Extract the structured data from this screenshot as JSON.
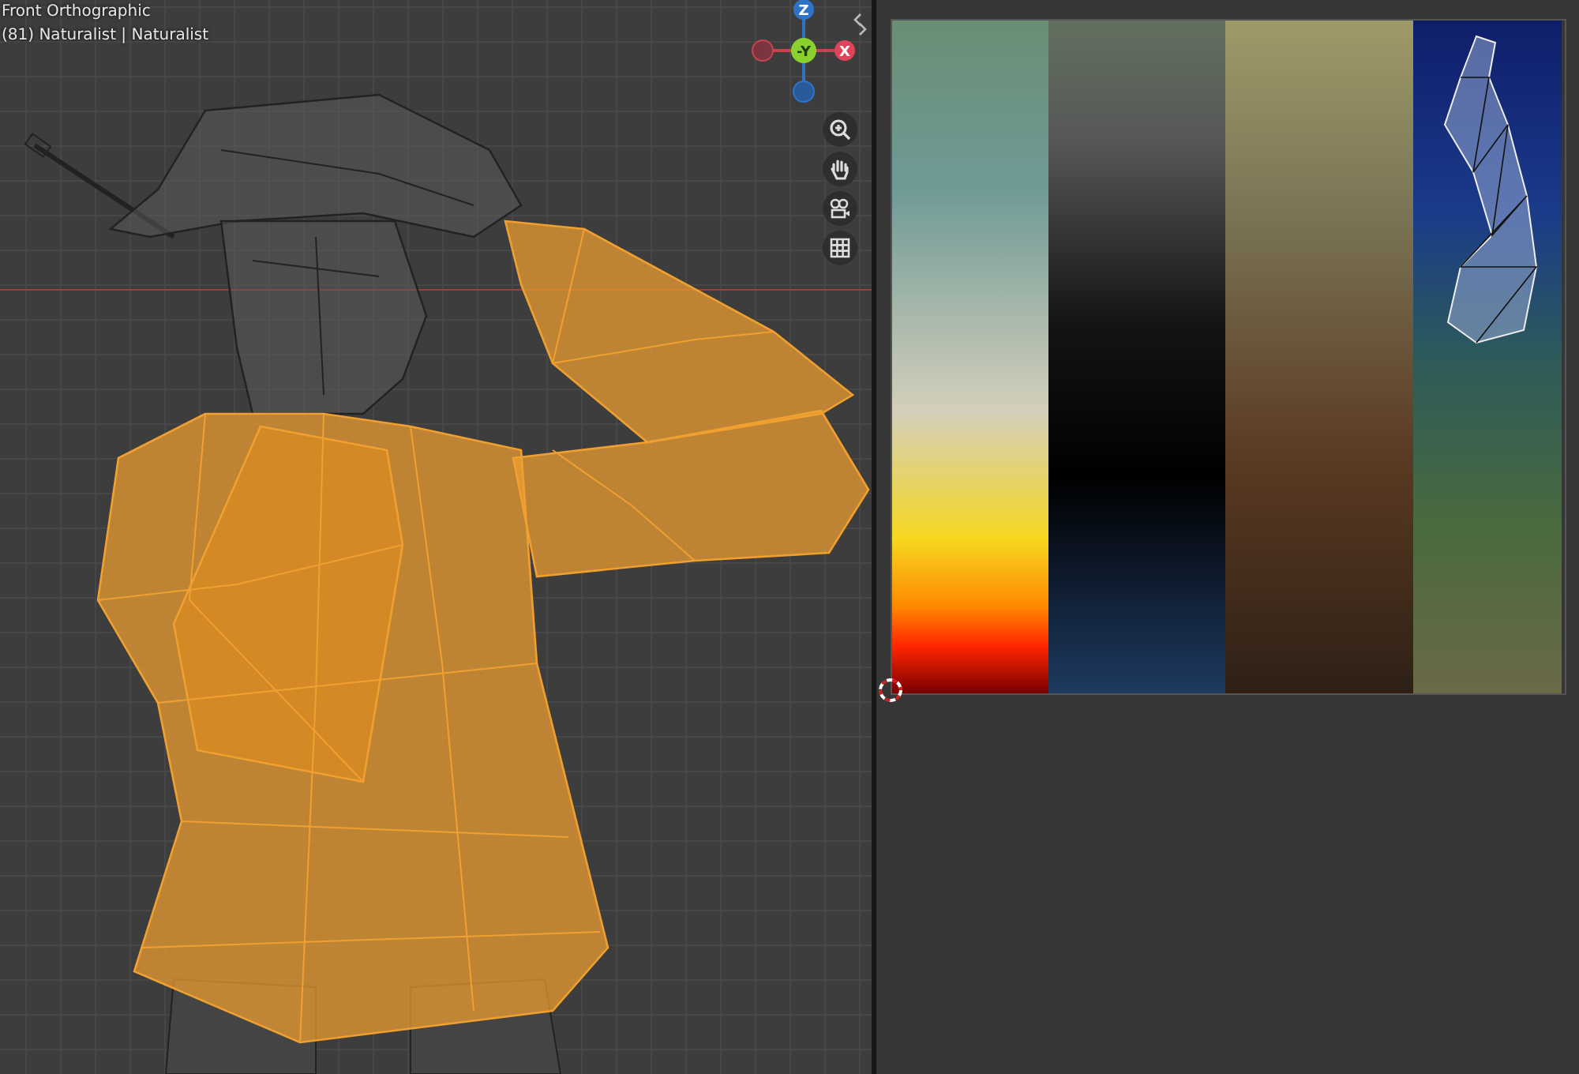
{
  "viewport": {
    "view_name": "Front Orthographic",
    "collection_info": "(81) Naturalist | Naturalist",
    "gizmo": {
      "axes": [
        {
          "label": "Z",
          "kind": "z"
        },
        {
          "label": "-Y",
          "kind": "y"
        },
        {
          "label": "X",
          "kind": "x"
        }
      ]
    }
  }
}
